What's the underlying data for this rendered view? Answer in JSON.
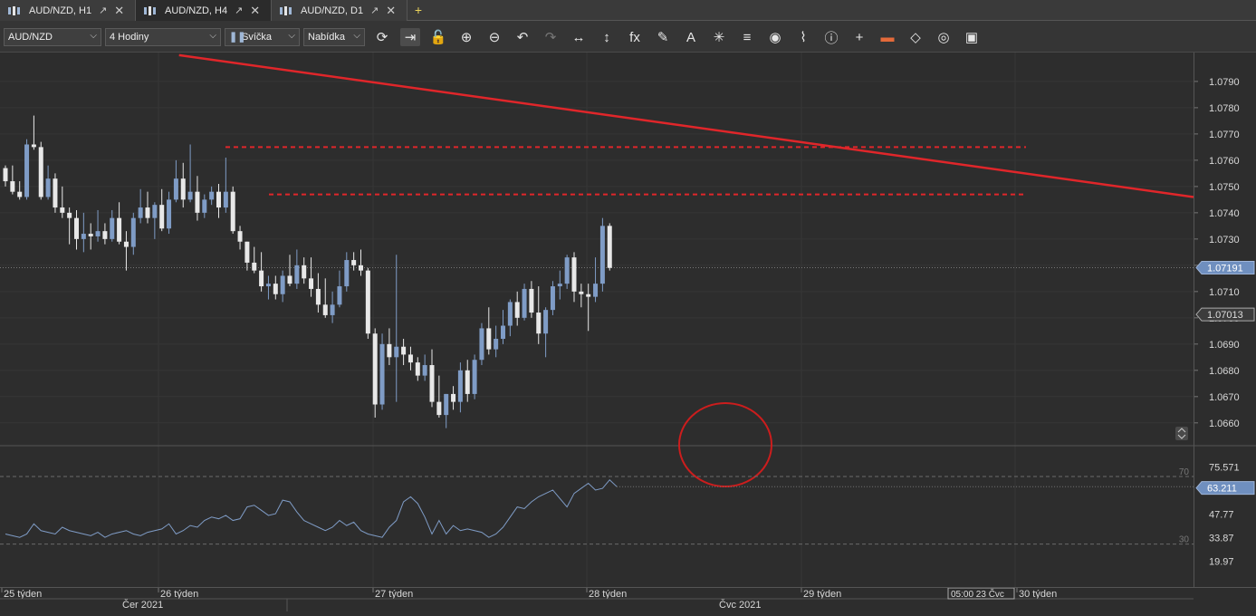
{
  "tabs": [
    {
      "label": "AUD/NZD, H1",
      "active": false
    },
    {
      "label": "AUD/NZD, H4",
      "active": true
    },
    {
      "label": "AUD/NZD, D1",
      "active": false
    }
  ],
  "toolbar": {
    "symbol": "AUD/NZD",
    "timeframe": "4 Hodiny",
    "chart_type": "Svíčka",
    "menu": "Nabídka",
    "tools": [
      "refresh-icon",
      "autoscroll-icon",
      "lock-icon",
      "zoom-in-icon",
      "zoom-out-icon",
      "undo-icon",
      "redo-icon",
      "horizontal-resize-icon",
      "vertical-resize-icon",
      "fx-icon",
      "pencil-icon",
      "text-icon",
      "objects-icon",
      "layers-icon",
      "eye-icon",
      "signal-icon",
      "info-icon",
      "crosshair-icon",
      "color-bar-icon",
      "fill-icon",
      "circle-icon",
      "save-icon"
    ]
  },
  "price_scale": {
    "labels": [
      "1.0790",
      "1.0780",
      "1.0770",
      "1.0760",
      "1.0750",
      "1.0740",
      "1.0730",
      "1.0720",
      "1.0710",
      "1.0700",
      "1.0690",
      "1.0680",
      "1.0670",
      "1.0660"
    ],
    "current_price": "1.07191",
    "marker_price": "1.07013"
  },
  "rsi_scale": {
    "labels": [
      "75.571",
      "47.77",
      "33.87",
      "19.97"
    ],
    "current": "63.211",
    "level_high": "70",
    "level_low": "30"
  },
  "time_axis": {
    "weeks": [
      "25 týden",
      "26 týden",
      "27 týden",
      "28 týden",
      "29 týden",
      "30 týden"
    ],
    "months": [
      "Čer 2021",
      "Čvc 2021"
    ],
    "cursor_time": "05:00 23 Čvc"
  },
  "colors": {
    "bull": "#7f9cc6",
    "bear": "#e8e8e8",
    "trendline": "#e0262a",
    "level": "#e0262a",
    "rsi": "#7f9cc6",
    "circle": "#cc1d1d"
  },
  "chart_data": {
    "type": "candlestick",
    "symbol": "AUD/NZD",
    "timeframe": "H4",
    "y_range": [
      1.0652,
      1.0801
    ],
    "candles": [
      [
        1.0757,
        1.0758,
        1.075,
        1.0752
      ],
      [
        1.0752,
        1.0758,
        1.0747,
        1.0748
      ],
      [
        1.0748,
        1.0752,
        1.0745,
        1.0746
      ],
      [
        1.0746,
        1.0768,
        1.0745,
        1.0766
      ],
      [
        1.0766,
        1.0777,
        1.0764,
        1.0765
      ],
      [
        1.0765,
        1.0767,
        1.0745,
        1.0746
      ],
      [
        1.0746,
        1.0758,
        1.0745,
        1.0753
      ],
      [
        1.0753,
        1.0755,
        1.074,
        1.0742
      ],
      [
        1.0742,
        1.075,
        1.0738,
        1.074
      ],
      [
        1.074,
        1.0742,
        1.0728,
        1.0738
      ],
      [
        1.0738,
        1.0741,
        1.0726,
        1.073
      ],
      [
        1.073,
        1.074,
        1.0725,
        1.0732
      ],
      [
        1.0732,
        1.0736,
        1.0726,
        1.0731
      ],
      [
        1.0731,
        1.0741,
        1.0729,
        1.0733
      ],
      [
        1.0733,
        1.0736,
        1.0728,
        1.073
      ],
      [
        1.073,
        1.0741,
        1.0729,
        1.0738
      ],
      [
        1.0738,
        1.0744,
        1.0728,
        1.0729
      ],
      [
        1.0729,
        1.0733,
        1.0718,
        1.0727
      ],
      [
        1.0727,
        1.074,
        1.0724,
        1.0738
      ],
      [
        1.0738,
        1.0749,
        1.0736,
        1.0742
      ],
      [
        1.0742,
        1.0748,
        1.0736,
        1.0738
      ],
      [
        1.0738,
        1.0744,
        1.073,
        1.0743
      ],
      [
        1.0743,
        1.0749,
        1.0733,
        1.0734
      ],
      [
        1.0734,
        1.0748,
        1.0732,
        1.0745
      ],
      [
        1.0745,
        1.076,
        1.0744,
        1.0753
      ],
      [
        1.0753,
        1.0759,
        1.0742,
        1.0745
      ],
      [
        1.0745,
        1.0766,
        1.0744,
        1.0748
      ],
      [
        1.0748,
        1.0754,
        1.0737,
        1.074
      ],
      [
        1.074,
        1.0747,
        1.0738,
        1.0745
      ],
      [
        1.0745,
        1.075,
        1.0743,
        1.0748
      ],
      [
        1.0748,
        1.0751,
        1.0738,
        1.0742
      ],
      [
        1.0742,
        1.0761,
        1.074,
        1.0748
      ],
      [
        1.0748,
        1.075,
        1.0732,
        1.0733
      ],
      [
        1.0733,
        1.0735,
        1.0726,
        1.0729
      ],
      [
        1.0729,
        1.0729,
        1.0718,
        1.0721
      ],
      [
        1.0721,
        1.0727,
        1.0717,
        1.0718
      ],
      [
        1.0718,
        1.0725,
        1.071,
        1.0712
      ],
      [
        1.0712,
        1.0716,
        1.0707,
        1.0713
      ],
      [
        1.0713,
        1.0716,
        1.0707,
        1.0709
      ],
      [
        1.0709,
        1.0718,
        1.0706,
        1.0716
      ],
      [
        1.0716,
        1.0724,
        1.0712,
        1.0713
      ],
      [
        1.0713,
        1.0726,
        1.0711,
        1.072
      ],
      [
        1.072,
        1.0723,
        1.0713,
        1.0715
      ],
      [
        1.0715,
        1.0723,
        1.0708,
        1.0711
      ],
      [
        1.0711,
        1.0717,
        1.0702,
        1.0705
      ],
      [
        1.0705,
        1.0715,
        1.07,
        1.0701
      ],
      [
        1.0701,
        1.071,
        1.0698,
        1.0705
      ],
      [
        1.0705,
        1.0718,
        1.0704,
        1.0712
      ],
      [
        1.0712,
        1.0725,
        1.071,
        1.0722
      ],
      [
        1.0722,
        1.0725,
        1.0718,
        1.072
      ],
      [
        1.072,
        1.0726,
        1.0716,
        1.0718
      ],
      [
        1.0718,
        1.0719,
        1.0692,
        1.0694
      ],
      [
        1.0694,
        1.0696,
        1.0662,
        1.0667
      ],
      [
        1.0667,
        1.0694,
        1.0665,
        1.069
      ],
      [
        1.069,
        1.0696,
        1.0682,
        1.0685
      ],
      [
        1.0685,
        1.0724,
        1.0668,
        1.0689
      ],
      [
        1.0689,
        1.0692,
        1.0682,
        1.0686
      ],
      [
        1.0686,
        1.0689,
        1.068,
        1.0683
      ],
      [
        1.0683,
        1.0685,
        1.0676,
        1.0678
      ],
      [
        1.0678,
        1.0686,
        1.0676,
        1.0682
      ],
      [
        1.0682,
        1.0688,
        1.0666,
        1.0668
      ],
      [
        1.0668,
        1.0678,
        1.0662,
        1.0663
      ],
      [
        1.0663,
        1.0671,
        1.0658,
        1.0671
      ],
      [
        1.0671,
        1.0674,
        1.0665,
        1.0668
      ],
      [
        1.0668,
        1.0683,
        1.0664,
        1.068
      ],
      [
        1.068,
        1.0684,
        1.0668,
        1.0671
      ],
      [
        1.0671,
        1.0686,
        1.0669,
        1.0684
      ],
      [
        1.0684,
        1.0698,
        1.0682,
        1.0696
      ],
      [
        1.0696,
        1.0704,
        1.0686,
        1.0688
      ],
      [
        1.0688,
        1.0697,
        1.0685,
        1.0692
      ],
      [
        1.0692,
        1.0703,
        1.069,
        1.0697
      ],
      [
        1.0697,
        1.0707,
        1.0693,
        1.0706
      ],
      [
        1.0706,
        1.071,
        1.0697,
        1.07
      ],
      [
        1.07,
        1.0713,
        1.0699,
        1.0711
      ],
      [
        1.0711,
        1.0714,
        1.07,
        1.0702
      ],
      [
        1.0702,
        1.0712,
        1.069,
        1.0694
      ],
      [
        1.0694,
        1.0704,
        1.0685,
        1.0703
      ],
      [
        1.0703,
        1.0714,
        1.0701,
        1.0712
      ],
      [
        1.0712,
        1.0718,
        1.0707,
        1.0713
      ],
      [
        1.0713,
        1.0724,
        1.0711,
        1.0723
      ],
      [
        1.0723,
        1.0725,
        1.0706,
        1.071
      ],
      [
        1.071,
        1.0713,
        1.0704,
        1.0709
      ],
      [
        1.0709,
        1.0713,
        1.0695,
        1.0708
      ],
      [
        1.0708,
        1.0723,
        1.0706,
        1.0713
      ],
      [
        1.0713,
        1.0738,
        1.071,
        1.0735
      ],
      [
        1.0735,
        1.0736,
        1.0718,
        1.0719
      ]
    ],
    "levels": [
      1.0765,
      1.0747
    ],
    "trendline": [
      [
        0.15,
        1.08
      ],
      [
        1.0,
        1.0746
      ]
    ],
    "rsi": {
      "ylim": [
        10,
        85
      ],
      "levels": [
        70,
        30
      ],
      "values": [
        36,
        35,
        34,
        36,
        42,
        38,
        37,
        36,
        40,
        38,
        37,
        36,
        35,
        37,
        34,
        36,
        37,
        38,
        36,
        35,
        37,
        38,
        39,
        42,
        36,
        38,
        41,
        40,
        44,
        46,
        45,
        47,
        44,
        45,
        52,
        53,
        50,
        47,
        48,
        56,
        55,
        49,
        44,
        42,
        40,
        38,
        40,
        44,
        41,
        43,
        38,
        36,
        35,
        34,
        40,
        44,
        55,
        58,
        54,
        46,
        36,
        44,
        36,
        41,
        38,
        39,
        38,
        37,
        34,
        36,
        40,
        46,
        52,
        51,
        55,
        58,
        60,
        62,
        57,
        52,
        60,
        63,
        66,
        62,
        63,
        68,
        64
      ]
    }
  }
}
